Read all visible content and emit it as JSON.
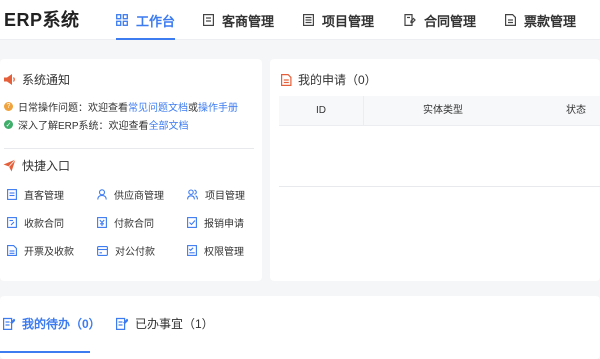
{
  "brand": "ERP系统",
  "nav": [
    {
      "label": "工作台",
      "icon": "grid-icon",
      "active": true
    },
    {
      "label": "客商管理",
      "icon": "book-icon"
    },
    {
      "label": "项目管理",
      "icon": "list-icon"
    },
    {
      "label": "合同管理",
      "icon": "contract-icon"
    },
    {
      "label": "票款管理",
      "icon": "invoice-icon"
    }
  ],
  "notice": {
    "title": "系统通知",
    "line1": {
      "prefix": "日常操作问题：欢迎查看 ",
      "link1": "常见问题文档",
      "mid": " 或 ",
      "link2": "操作手册"
    },
    "line2": {
      "prefix": "深入了解ERP系统：欢迎查看 ",
      "link1": "全部文档"
    }
  },
  "quick": {
    "title": "快捷入口",
    "items": [
      "直客管理",
      "供应商管理",
      "项目管理",
      "收款合同",
      "付款合同",
      "报销申请",
      "开票及收款",
      "对公付款",
      "权限管理"
    ]
  },
  "applications": {
    "title": "我的申请（0）",
    "columns": [
      "ID",
      "实体类型",
      "状态"
    ]
  },
  "tabs": [
    {
      "label": "我的待办（0）",
      "active": true
    },
    {
      "label": "已办事宜（1）"
    }
  ],
  "colors": {
    "accent": "#3c7bf0",
    "notice_icon": "#e5603a",
    "warn": "#f0a23c",
    "ok": "#3fae6a"
  }
}
